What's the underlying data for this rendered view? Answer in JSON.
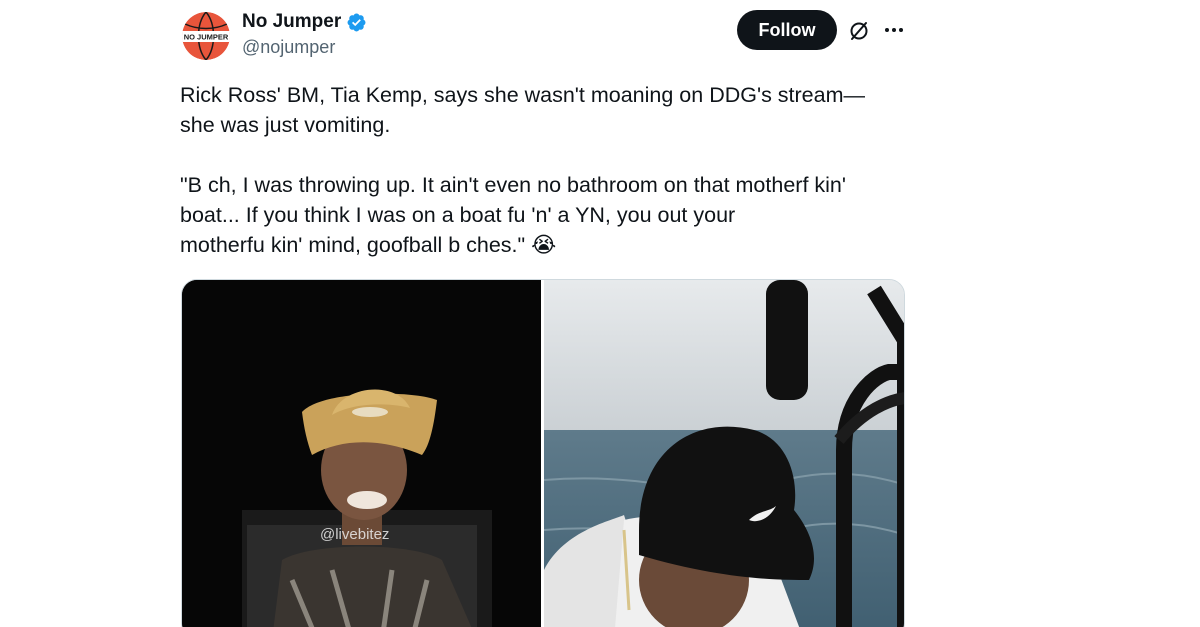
{
  "author": {
    "display_name": "No Jumper",
    "handle": "@nojumper",
    "verified": true,
    "avatar_text": "NO JUMPER",
    "avatar_colors": {
      "ball": "#e8553b",
      "band": "#ffffff",
      "text": "#1a1a1a"
    }
  },
  "actions": {
    "follow_label": "Follow",
    "grok_icon": "grok-slash-circle-icon",
    "more_icon": "more-horizontal-icon"
  },
  "tweet": {
    "paragraph_1": "Rick Ross' BM, Tia Kemp, says she wasn't moaning on DDG's stream—\nshe was just vomiting.",
    "paragraph_2": "\"B  ch, I was throwing up. It ain't even no bathroom on that motherf    kin'\nboat... If you think I was on a boat fu    'n' a YN, you out your\nmotherfu    kin' mind, goofball b    ches.\" 😭"
  },
  "media": {
    "left_watermark": "@livebitez",
    "left_description_icon": "video-frame-woman-cowboy-hat",
    "right_description_icon": "video-frame-man-black-cap-boat"
  },
  "colors": {
    "text_primary": "#0f1419",
    "text_secondary": "#536471",
    "verified_blue": "#1d9bf0",
    "follow_bg": "#0f1419",
    "border": "#cfd9de"
  }
}
